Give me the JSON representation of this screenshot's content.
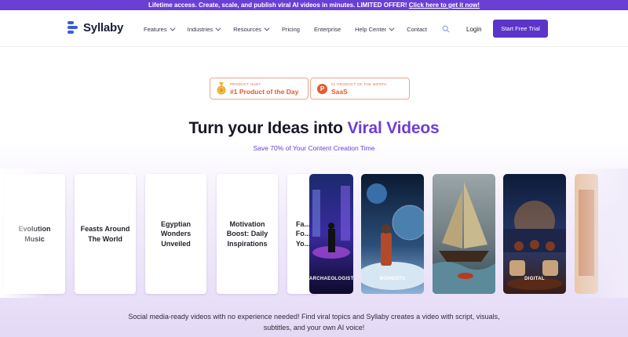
{
  "promo": {
    "text": "Lifetime access. Create, scale, and publish viral AI videos in minutes. LIMITED OFFER! ",
    "link": "Click here to get it now!"
  },
  "nav": {
    "logo": "Syllaby",
    "items": [
      {
        "label": "Features",
        "dropdown": true
      },
      {
        "label": "Industries",
        "dropdown": true
      },
      {
        "label": "Resources",
        "dropdown": true
      },
      {
        "label": "Pricing",
        "dropdown": false
      },
      {
        "label": "Enterprise",
        "dropdown": false
      },
      {
        "label": "Help Center",
        "dropdown": true
      },
      {
        "label": "Contact",
        "dropdown": false
      }
    ],
    "login": "Login",
    "cta": "Start Free Trial"
  },
  "badges": {
    "day": {
      "small": "PRODUCT HUNT",
      "big": "#1 Product of the Day"
    },
    "month": {
      "small": "#1 PRODUCT OF THE MONTH",
      "big": "SaaS"
    }
  },
  "hero": {
    "title_plain": "Turn your Ideas into ",
    "title_accent": "Viral Videos",
    "subtitle": "Save 70% of Your Content Creation Time"
  },
  "cards": [
    "Evolution Music",
    "Feasts Around The World",
    "Egyptian Wonders Unveiled",
    "Motivation Boost: Daily Inspirations",
    "Fa... Fo... Yo..."
  ],
  "thumbnails": [
    {
      "caption": "ARCHAEOLOGISTS"
    },
    {
      "caption": "MOMENTS"
    },
    {
      "caption": ""
    },
    {
      "caption": "DIGITAL"
    }
  ],
  "description": "Social media-ready videos with no experience needed! Find viral topics and Syllaby creates a video with script, visuals, subtitles, and your own AI voice!",
  "colors": {
    "brand": "#6a3fd6",
    "cta": "#5b34c9",
    "badge": "#e05a2f"
  }
}
